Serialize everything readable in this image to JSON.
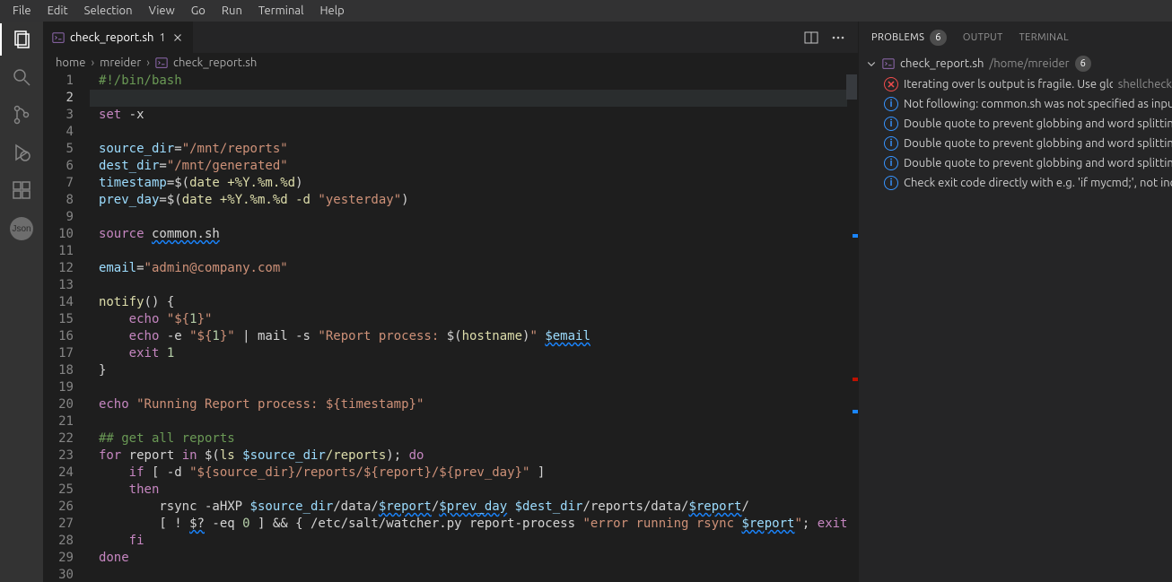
{
  "menubar": [
    "File",
    "Edit",
    "Selection",
    "View",
    "Go",
    "Run",
    "Terminal",
    "Help"
  ],
  "activity": {
    "json_label": "Json"
  },
  "tab": {
    "filename": "check_report.sh",
    "modified_indicator": "1"
  },
  "breadcrumb": {
    "segments": [
      "home",
      "mreider"
    ],
    "file": "check_report.sh"
  },
  "editor": {
    "active_line": 2,
    "lines_plain": [
      "#!/bin/bash",
      "",
      "set -x",
      "",
      "source_dir=\"/mnt/reports\"",
      "dest_dir=\"/mnt/generated\"",
      "timestamp=$(date +%Y.%m.%d)",
      "prev_day=$(date +%Y.%m.%d -d \"yesterday\")",
      "",
      "source common.sh",
      "",
      "email=\"admin@company.com\"",
      "",
      "notify() {",
      "    echo \"${1}\"",
      "    echo -e \"${1}\" | mail -s \"Report process: $(hostname)\" $email",
      "    exit 1",
      "}",
      "",
      "echo \"Running Report process: ${timestamp}\"",
      "",
      "## get all reports",
      "for report in $(ls $source_dir/reports); do",
      "    if [ -d \"${source_dir}/reports/${report}/${prev_day}\" ]",
      "    then",
      "        rsync -aHXP $source_dir/data/$report/$prev_day $dest_dir/reports/data/$report/",
      "        [ ! $? -eq 0 ] && { /etc/salt/watcher.py report-process \"error running rsync $report\"; exit",
      "    fi",
      "done",
      ""
    ]
  },
  "panel": {
    "tabs": {
      "problems": "PROBLEMS",
      "problems_count": "6",
      "output": "OUTPUT",
      "terminal": "TERMINAL"
    },
    "file": {
      "name": "check_report.sh",
      "dir": "/home/mreider",
      "count": "6"
    },
    "items": [
      {
        "severity": "error",
        "msg": "Iterating over ls output is fragile. Use globs.",
        "source": "shellcheck"
      },
      {
        "severity": "info",
        "msg": "Not following: common.sh was not specified as input",
        "source": ""
      },
      {
        "severity": "info",
        "msg": "Double quote to prevent globbing and word splitting.",
        "source": ""
      },
      {
        "severity": "info",
        "msg": "Double quote to prevent globbing and word splitting.",
        "source": ""
      },
      {
        "severity": "info",
        "msg": "Double quote to prevent globbing and word splitting.",
        "source": ""
      },
      {
        "severity": "info",
        "msg": "Check exit code directly with e.g. 'if mycmd;', not indirectly with $?.",
        "source": ""
      }
    ]
  },
  "colors": {
    "accent": "#007acc"
  }
}
